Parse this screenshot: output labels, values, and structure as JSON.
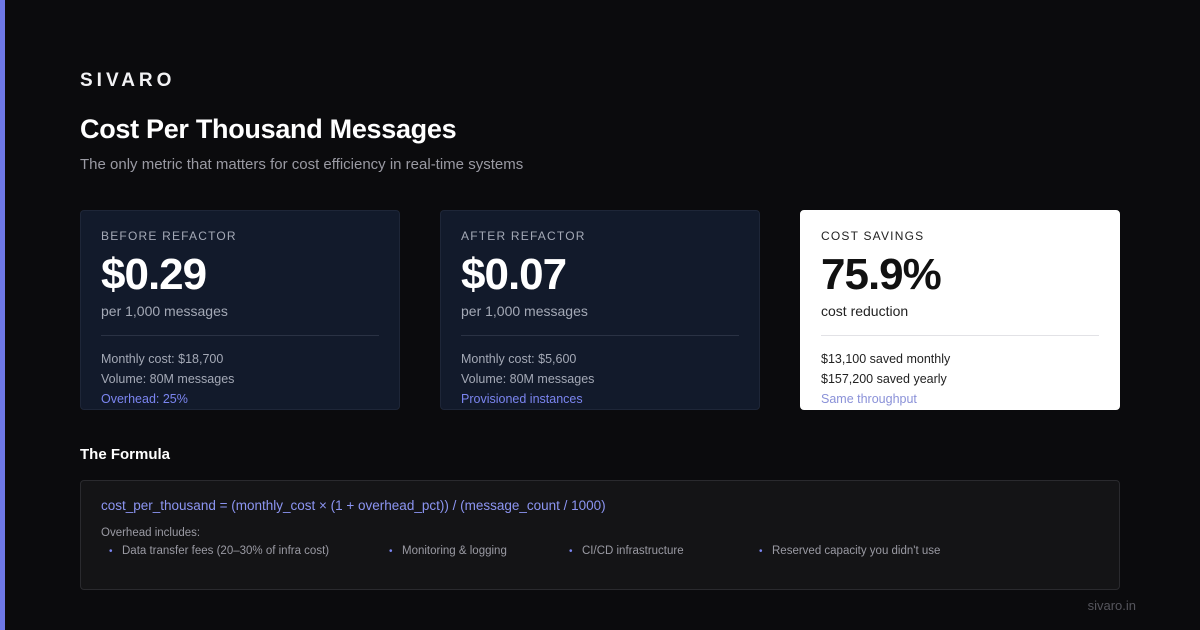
{
  "brand": "SIVARO",
  "title": "Cost Per Thousand Messages",
  "subtitle": "The only metric that matters for cost efficiency in real-time systems",
  "cards": [
    {
      "label": "BEFORE REFACTOR",
      "value": "$0.29",
      "unit": "per 1,000 messages",
      "lines": [
        "Monthly cost: $18,700",
        "Volume: 80M messages"
      ],
      "highlight": "Overhead: 25%"
    },
    {
      "label": "AFTER REFACTOR",
      "value": "$0.07",
      "unit": "per 1,000 messages",
      "lines": [
        "Monthly cost: $5,600",
        "Volume: 80M messages"
      ],
      "highlight": "Provisioned instances"
    },
    {
      "label": "COST SAVINGS",
      "value": "75.9%",
      "unit": "cost reduction",
      "lines": [
        "$13,100 saved monthly",
        "$157,200 saved yearly"
      ],
      "highlight": "Same throughput"
    }
  ],
  "formula_section": {
    "title": "The Formula",
    "formula": "cost_per_thousand = (monthly_cost × (1 + overhead_pct)) / (message_count / 1000)",
    "overhead_title": "Overhead includes:",
    "items": [
      "Data transfer fees (20–30% of infra cost)",
      "Monitoring & logging",
      "CI/CD infrastructure",
      "Reserved capacity you didn't use"
    ]
  },
  "footer": "sivaro.in",
  "colors": {
    "background": "#0b0b0d",
    "accent": "#6e78e6",
    "card_dark": "#121a2b",
    "card_light": "#ffffff",
    "formula_text": "#8c95f2"
  }
}
